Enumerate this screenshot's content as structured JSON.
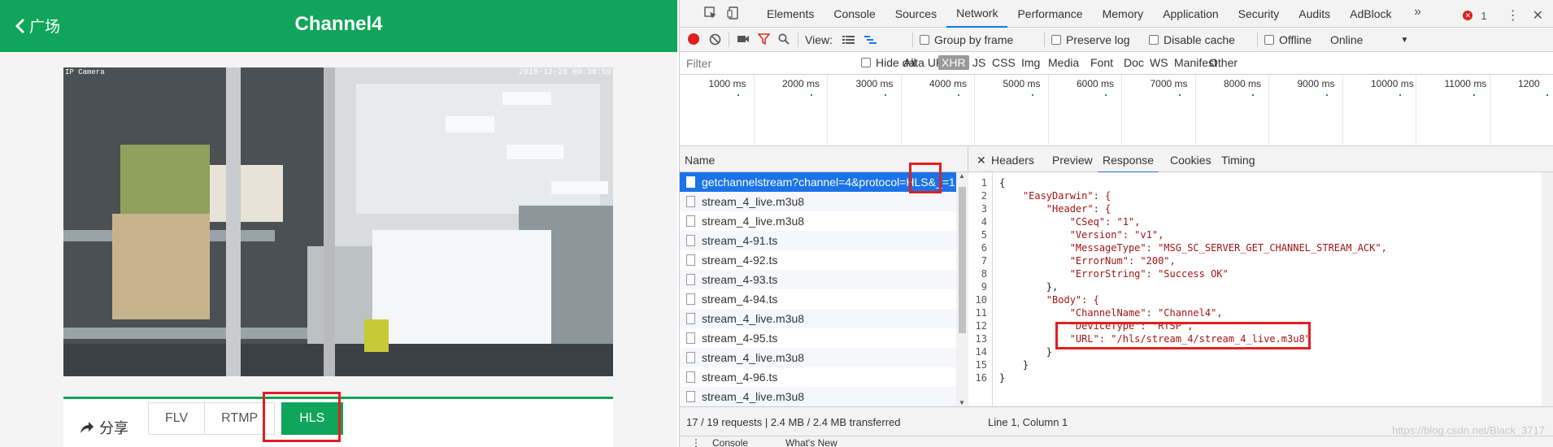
{
  "mobile": {
    "back_label": "广场",
    "title": "Channel4",
    "video_label_left": "IP Camera",
    "video_label_right": "2018-12-28 09:38:59",
    "share_label": "分享",
    "protocols": [
      "FLV",
      "RTMP",
      "HLS"
    ],
    "active_protocol": "HLS",
    "colors": {
      "brand": "#0fa55a",
      "highlight": "#e02020"
    }
  },
  "devtools": {
    "tabs": [
      "Elements",
      "Console",
      "Sources",
      "Network",
      "Performance",
      "Memory",
      "Application",
      "Security",
      "Audits",
      "AdBlock"
    ],
    "active_tab": "Network",
    "more_tabs": "»",
    "error_count": "1",
    "toolbar": {
      "view_label": "View:",
      "group_by_frame": "Group by frame",
      "preserve_log": "Preserve log",
      "disable_cache": "Disable cache",
      "offline": "Offline",
      "throttle": "Online"
    },
    "filterbar": {
      "placeholder": "Filter",
      "hide_data_urls": "Hide data URLs",
      "types": [
        "All",
        "XHR",
        "JS",
        "CSS",
        "Img",
        "Media",
        "Font",
        "Doc",
        "WS",
        "Manifest",
        "Other"
      ],
      "active_type": "XHR"
    },
    "timeline_ticks": [
      "1000 ms",
      "2000 ms",
      "3000 ms",
      "4000 ms",
      "5000 ms",
      "6000 ms",
      "7000 ms",
      "8000 ms",
      "9000 ms",
      "10000 ms",
      "11000 ms",
      "1200"
    ],
    "requests": {
      "header": "Name",
      "items": [
        "getchannelstream?channel=4&protocol=HLS&_=1",
        "stream_4_live.m3u8",
        "stream_4_live.m3u8",
        "stream_4-91.ts",
        "stream_4-92.ts",
        "stream_4-93.ts",
        "stream_4-94.ts",
        "stream_4_live.m3u8",
        "stream_4-95.ts",
        "stream_4_live.m3u8",
        "stream_4-96.ts",
        "stream_4_live.m3u8"
      ]
    },
    "detail_tabs": [
      "Headers",
      "Preview",
      "Response",
      "Cookies",
      "Timing"
    ],
    "active_detail_tab": "Response",
    "close_glyph": "✕",
    "response_lines": [
      "{",
      "    \"EasyDarwin\": {",
      "        \"Header\": {",
      "            \"CSeq\": \"1\",",
      "            \"Version\": \"v1\",",
      "            \"MessageType\": \"MSG_SC_SERVER_GET_CHANNEL_STREAM_ACK\",",
      "            \"ErrorNum\": \"200\",",
      "            \"ErrorString\": \"Success OK\"",
      "        },",
      "        \"Body\": {",
      "            \"ChannelName\": \"Channel4\",",
      "            \"DeviceType\": \"RTSP\",",
      "            \"URL\": \"/hls/stream_4/stream_4_live.m3u8\"",
      "        }",
      "    }",
      "}"
    ],
    "line_numbers": [
      "1",
      "2",
      "3",
      "4",
      "5",
      "6",
      "7",
      "8",
      "9",
      "10",
      "11",
      "12",
      "13",
      "14",
      "15",
      "16"
    ],
    "status_left": "17 / 19 requests  |  2.4 MB / 2.4 MB transferred",
    "status_right": "Line 1, Column 1",
    "drawer_tabs": [
      "Console",
      "What's New"
    ],
    "watermark": "https://blog.csdn.net/Black_3717"
  }
}
